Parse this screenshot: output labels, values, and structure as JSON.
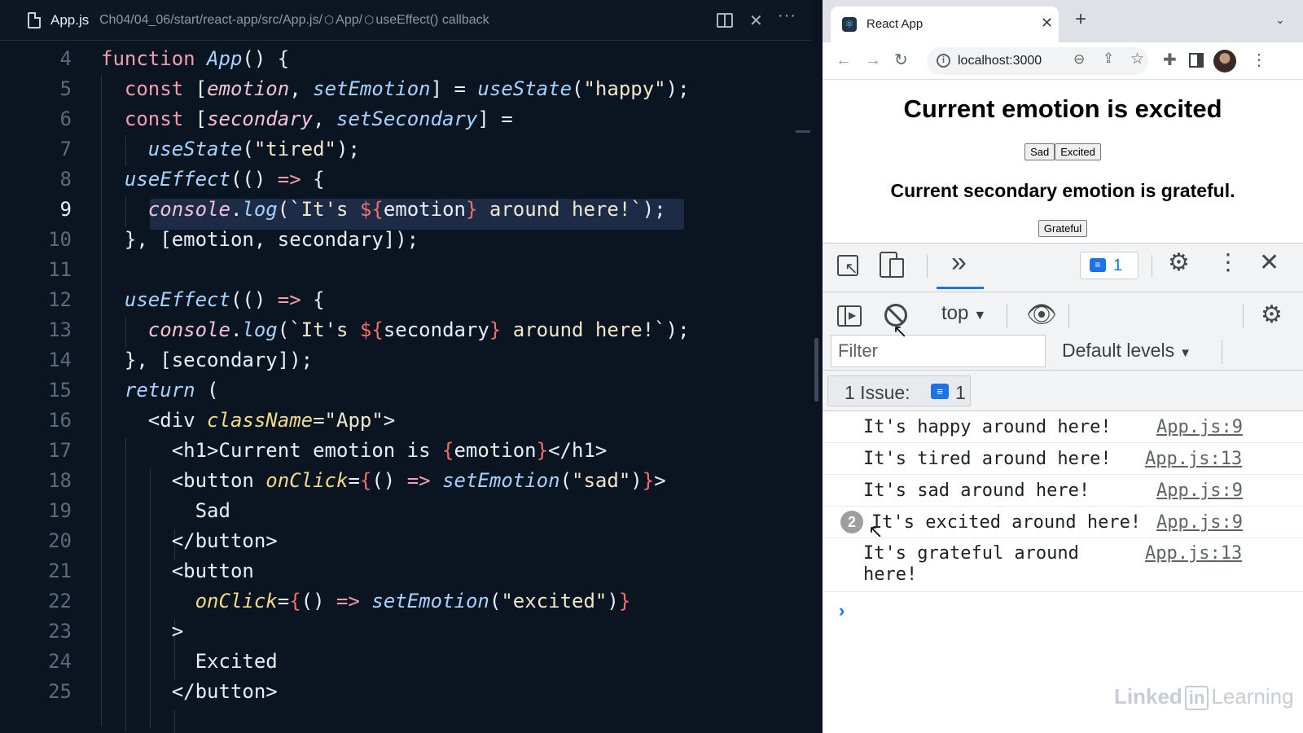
{
  "editor": {
    "filename": "App.js",
    "breadcrumb": {
      "path": "Ch04/04_06/start/react-app/src/App.js/",
      "symbol1": "App/",
      "symbol2": "useEffect() callback"
    },
    "line_numbers": [
      "4",
      "5",
      "6",
      "7",
      "8",
      "9",
      "10",
      "11",
      "12",
      "13",
      "14",
      "15",
      "16",
      "17",
      "18",
      "19",
      "20",
      "21",
      "22",
      "23",
      "24",
      "25"
    ],
    "active_line": "9"
  },
  "browser": {
    "tab_title": "React App",
    "url": "localhost:3000",
    "page": {
      "heading": "Current emotion is excited",
      "sad_button": "Sad",
      "excited_button": "Excited",
      "secondary_heading": "Current secondary emotion is grateful.",
      "grateful_button": "Grateful"
    },
    "devtools": {
      "issues_count": "1",
      "context": "top",
      "filter_placeholder": "Filter",
      "log_levels": "Default levels",
      "issues_bar": {
        "label": "1 Issue:",
        "count": "1"
      },
      "console": [
        {
          "message": "It's happy around here!",
          "source": "App.js:9"
        },
        {
          "message": "It's tired around here!",
          "source": "App.js:13"
        },
        {
          "message": "It's sad around here!",
          "source": "App.js:9"
        },
        {
          "message": "It's excited around here!",
          "source": "App.js:9",
          "repeat": "2"
        },
        {
          "message": "It's grateful around\nhere!",
          "source": "App.js:13"
        }
      ],
      "prompt": "›"
    }
  },
  "watermark": {
    "part1": "Linked",
    "part2": "in",
    "part3": "Learning"
  },
  "icons": {
    "file": "file-icon",
    "split": "split-editor-icon",
    "close": "close-icon",
    "more": "more-actions-icon",
    "react": "react-favicon",
    "info": "site-info-icon",
    "zoom": "zoom-icon",
    "share": "share-icon",
    "bookmark": "star-icon",
    "extensions": "puzzle-icon",
    "inspect": "inspect-element-icon",
    "device": "device-toggle-icon",
    "settings": "gear-icon",
    "eye": "eye-icon",
    "clear": "clear-console-icon"
  }
}
